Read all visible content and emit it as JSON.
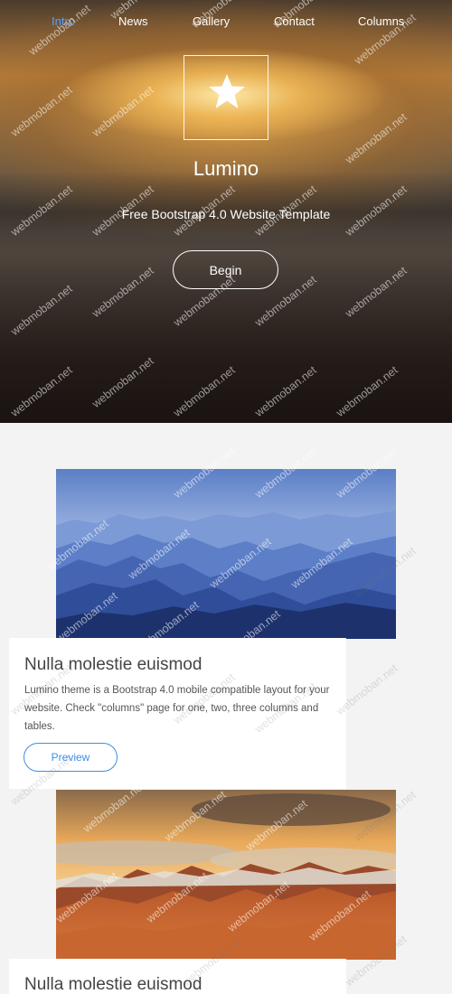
{
  "nav": {
    "items": [
      {
        "label": "Intro",
        "active": true
      },
      {
        "label": "News"
      },
      {
        "label": "Gallery"
      },
      {
        "label": "Contact"
      },
      {
        "label": "Columns"
      }
    ]
  },
  "hero": {
    "logo_icon": "star-icon",
    "title": "Lumino",
    "subtitle": "Free Bootstrap 4.0 Website Template",
    "cta_label": "Begin"
  },
  "cards": [
    {
      "image": "blue-misty-mountains",
      "title": "Nulla molestie euismod",
      "text": "Lumino theme is a Bootstrap 4.0 mobile compatible layout for your website. Check \"columns\" page for one, two, three columns and tables.",
      "button_label": "Preview"
    },
    {
      "image": "orange-sunset-mountains",
      "title": "Nulla molestie euismod"
    }
  ],
  "watermark": "webmoban.net",
  "colors": {
    "accent": "#3d8fe6",
    "nav_active": "#5aa2f0",
    "page_bg": "#f3f3f3"
  }
}
